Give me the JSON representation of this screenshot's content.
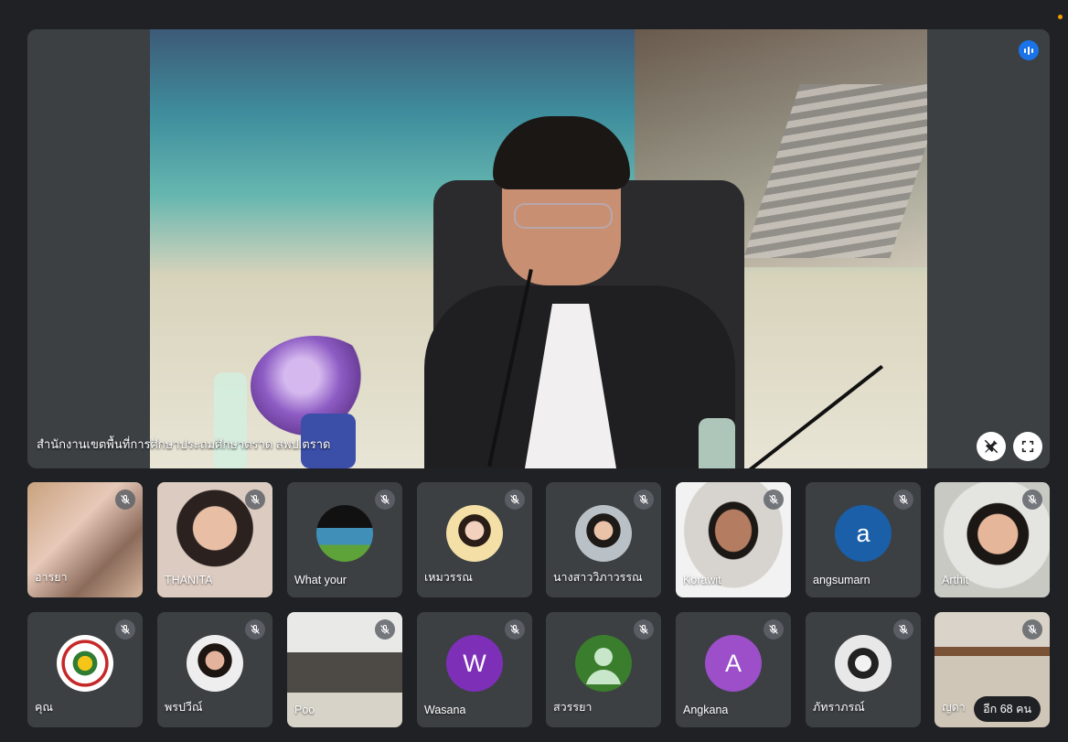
{
  "main": {
    "presenter_name": "สำนักงานเขตพื้นที่การศึกษาประถมศึกษาตราด สพป.ตราด",
    "pin_button_icon": "unpin-icon",
    "fullscreen_button_icon": "fullscreen-icon",
    "speaking_icon": "audio-level-icon"
  },
  "participants_row1": [
    {
      "name": "อารยา"
    },
    {
      "name": "THANITA"
    },
    {
      "name": "What your"
    },
    {
      "name": "เหมวรรณ"
    },
    {
      "name": "นางสาววิภาวรรณ"
    },
    {
      "name": "Korawit"
    },
    {
      "name": "angsumarn",
      "initial": "a"
    },
    {
      "name": "Arthit"
    }
  ],
  "participants_row2": [
    {
      "name": "คุณ"
    },
    {
      "name": "พรปวีณ์"
    },
    {
      "name": "Poo"
    },
    {
      "name": "Wasana",
      "initial": "W"
    },
    {
      "name": "สวรรยา"
    },
    {
      "name": "Angkana",
      "initial": "A"
    },
    {
      "name": "ภัทราภรณ์"
    },
    {
      "name": "ญดา",
      "more_label": "อีก 68 คน"
    }
  ],
  "colors": {
    "background": "#202124",
    "tile": "#3c4043",
    "accent_blue": "#1a73e8",
    "avatar_angsumarn": "#1a5fa8",
    "avatar_wasana": "#7e2fb8",
    "avatar_angkana": "#9c4fc9",
    "avatar_default": "#3a7d2c"
  },
  "tile_icon": "mic-off-icon"
}
